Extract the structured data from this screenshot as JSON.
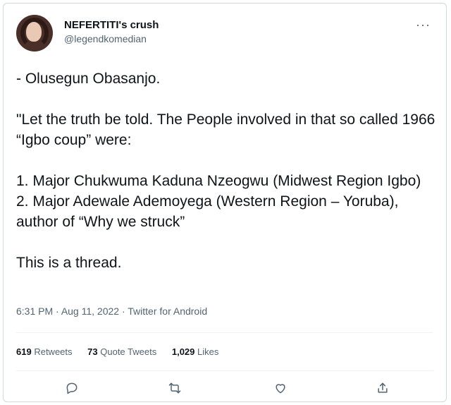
{
  "tweet": {
    "display_name": "NEFERTITI's crush",
    "handle": "@legendkomedian",
    "lines": {
      "l1": "- Olusegun Obasanjo.",
      "l2": "\"Let the truth be told. The People involved in that so called 1966 “Igbo coup” were:",
      "l3": "1. Major Chukwuma Kaduna Nzeogwu (Midwest Region Igbo)",
      "l4": "2. Major Adewale Ademoyega (Western Region – Yoruba), author of “Why we struck”",
      "l5": "This is a thread."
    },
    "time": "6:31 PM",
    "date": "Aug 11, 2022",
    "source": "Twitter for Android",
    "sep": " · "
  },
  "stats": {
    "retweets_count": "619",
    "retweets_label": "Retweets",
    "quotes_count": "73",
    "quotes_label": "Quote Tweets",
    "likes_count": "1,029",
    "likes_label": "Likes"
  },
  "icons": {
    "more": "more-icon",
    "reply": "reply-icon",
    "retweet": "retweet-icon",
    "like": "heart-icon",
    "share": "share-icon"
  }
}
